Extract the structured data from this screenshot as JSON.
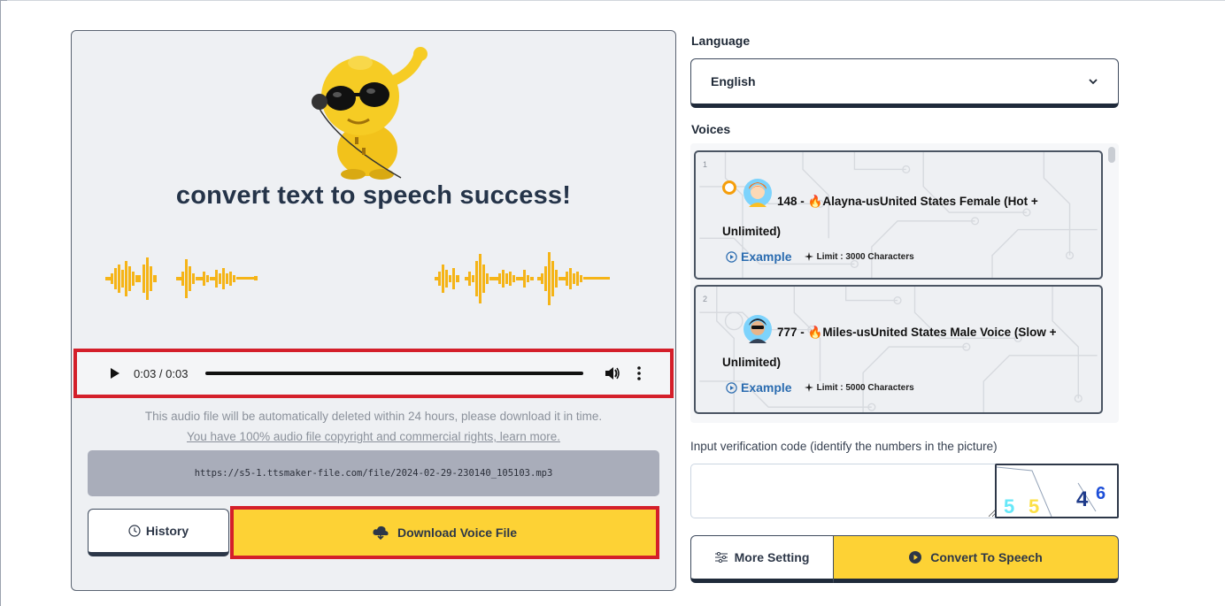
{
  "result": {
    "title": "convert text to speech success!",
    "audio": {
      "time": "0:03 / 0:03",
      "progress": 1.0
    },
    "notice": "This audio file will be automatically deleted within 24 hours, please download it in time.",
    "rights_link": "You have 100% audio file copyright and commercial rights, learn more.",
    "file_url": "https://s5-1.ttsmaker-file.com/file/2024-02-29-230140_105103.mp3",
    "history_label": "History",
    "download_label": "Download Voice File"
  },
  "settings": {
    "language_label": "Language",
    "language_value": "English",
    "voices_label": "Voices",
    "voices": [
      {
        "index": "1",
        "title_line1": "148 - 🔥Alayna-usUnited States Female (Hot +",
        "title_line2": "Unlimited)",
        "example_label": "Example",
        "limit": "Limit : 3000 Characters",
        "selected": true
      },
      {
        "index": "2",
        "title_line1": "777 - 🔥Miles-usUnited States Male Voice (Slow +",
        "title_line2": "Unlimited)",
        "example_label": "Example",
        "limit": "Limit : 5000 Characters",
        "selected": false
      }
    ],
    "verification_label": "Input verification code (identify the numbers in the picture)",
    "verification_value": "",
    "captcha_chars": [
      "5",
      "5",
      "4",
      "6"
    ],
    "more_setting_label": "More Setting",
    "convert_label": "Convert To Speech"
  },
  "colors": {
    "accent_yellow": "#fdd235",
    "highlight_red": "#d41f2a",
    "link_blue": "#2b6cb0",
    "wave_orange": "#f5b417"
  }
}
